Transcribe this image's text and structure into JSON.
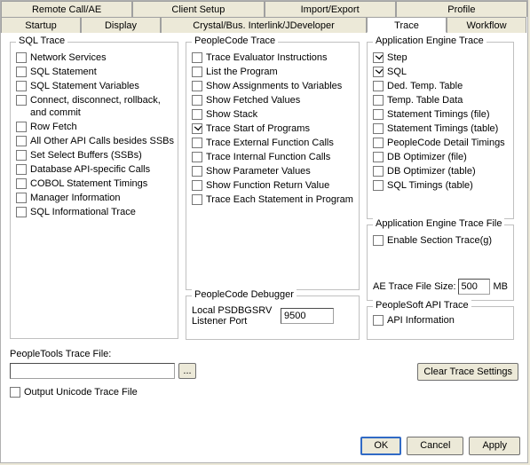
{
  "tabs_row1": [
    {
      "label": "Remote Call/AE"
    },
    {
      "label": "Client Setup"
    },
    {
      "label": "Import/Export"
    },
    {
      "label": "Profile"
    }
  ],
  "tabs_row2": [
    {
      "label": "Startup"
    },
    {
      "label": "Display"
    },
    {
      "label": "Crystal/Bus. Interlink/JDeveloper"
    },
    {
      "label": "Trace",
      "active": true
    },
    {
      "label": "Workflow"
    }
  ],
  "sql_trace": {
    "title": "SQL Trace",
    "items": [
      {
        "label": "Network Services"
      },
      {
        "label": "SQL Statement"
      },
      {
        "label": "SQL Statement Variables"
      },
      {
        "label": "Connect, disconnect, rollback, and commit"
      },
      {
        "label": "Row Fetch"
      },
      {
        "label": "All Other API Calls besides SSBs"
      },
      {
        "label": "Set Select Buffers (SSBs)"
      },
      {
        "label": "Database API-specific Calls"
      },
      {
        "label": "COBOL Statement Timings"
      },
      {
        "label": "Manager Information"
      },
      {
        "label": "SQL Informational Trace"
      }
    ]
  },
  "peoplecode_trace": {
    "title": "PeopleCode Trace",
    "items": [
      {
        "label": "Trace Evaluator Instructions"
      },
      {
        "label": "List the Program"
      },
      {
        "label": "Show Assignments to Variables"
      },
      {
        "label": "Show Fetched Values"
      },
      {
        "label": "Show Stack"
      },
      {
        "label": "Trace Start of Programs",
        "checked": true
      },
      {
        "label": "Trace External Function Calls"
      },
      {
        "label": "Trace Internal Function Calls"
      },
      {
        "label": "Show Parameter Values"
      },
      {
        "label": "Show Function Return Value"
      },
      {
        "label": "Trace Each Statement in Program"
      }
    ]
  },
  "ae_trace": {
    "title": "Application Engine Trace",
    "items": [
      {
        "label": "Step",
        "checked": true
      },
      {
        "label": "SQL",
        "checked": true
      },
      {
        "label": "Ded. Temp. Table"
      },
      {
        "label": "Temp. Table Data"
      },
      {
        "label": "Statement Timings (file)"
      },
      {
        "label": "Statement Timings (table)"
      },
      {
        "label": "PeopleCode Detail Timings"
      },
      {
        "label": "DB Optimizer (file)"
      },
      {
        "label": "DB Optimizer (table)"
      },
      {
        "label": "SQL Timings (table)"
      }
    ]
  },
  "ae_trace_file": {
    "title": "Application Engine Trace File",
    "enable_label": "Enable Section Trace(g)",
    "size_label": "AE Trace File Size:",
    "size_value": "500",
    "size_unit": "MB"
  },
  "pc_debugger": {
    "title": "PeopleCode Debugger",
    "port_label": "Local PSDBGSRV Listener Port",
    "port_value": "9500"
  },
  "ps_api_trace": {
    "title": "PeopleSoft API Trace",
    "item_label": "API Information"
  },
  "trace_file": {
    "label": "PeopleTools Trace File:",
    "value": "",
    "browse": "...",
    "unicode_label": "Output Unicode Trace File"
  },
  "clear_btn": "Clear Trace Settings",
  "buttons": {
    "ok": "OK",
    "cancel": "Cancel",
    "apply": "Apply"
  }
}
